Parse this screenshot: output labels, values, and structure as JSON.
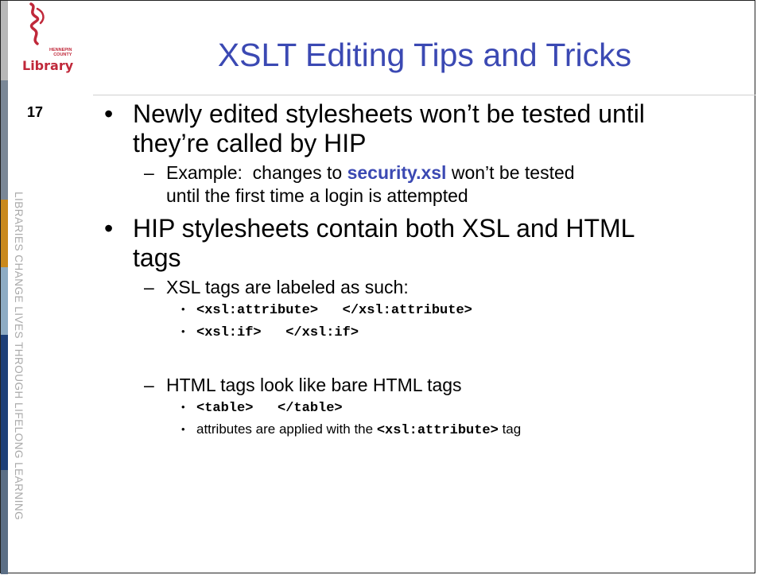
{
  "slide": {
    "title": "XSLT Editing Tips and Tricks",
    "number": "17"
  },
  "logo": {
    "county_line1": "HENNEPIN",
    "county_line2": "COUNTY",
    "name": "Library"
  },
  "rail": {
    "tagline": "LIBRARIES CHANGE LIVES THROUGH LIFELONG LEARNING",
    "stripe_colors": [
      "#b8b8b8",
      "#7a8796",
      "#c9891d",
      "#8eacc4",
      "#1d3f78",
      "#5b6e85"
    ]
  },
  "bullets": {
    "b1": {
      "line1": "Newly edited stylesheets won’t be tested until",
      "line2": "they’re called by HIP",
      "sub1": {
        "prefix": "Example:  changes to ",
        "file": "security.xsl",
        "suffix": " won’t be tested",
        "line2": "until the first time a login is attempted"
      }
    },
    "b2": {
      "line1": "HIP stylesheets contain both XSL and HTML",
      "line2": "tags",
      "sub1": {
        "text": "XSL tags are labeled as such:",
        "items": [
          "<xsl:attribute>   </xsl:attribute>",
          "<xsl:if>   </xsl:if>"
        ]
      },
      "sub2": {
        "text": "HTML tags look like bare HTML tags",
        "item1": "<table>   </table>",
        "item2_prefix": "attributes are applied with the ",
        "item2_code": "<xsl:attribute>",
        "item2_suffix": " tag"
      }
    }
  },
  "colors": {
    "title": "#3b49b3",
    "brand_red": "#c0283a"
  }
}
